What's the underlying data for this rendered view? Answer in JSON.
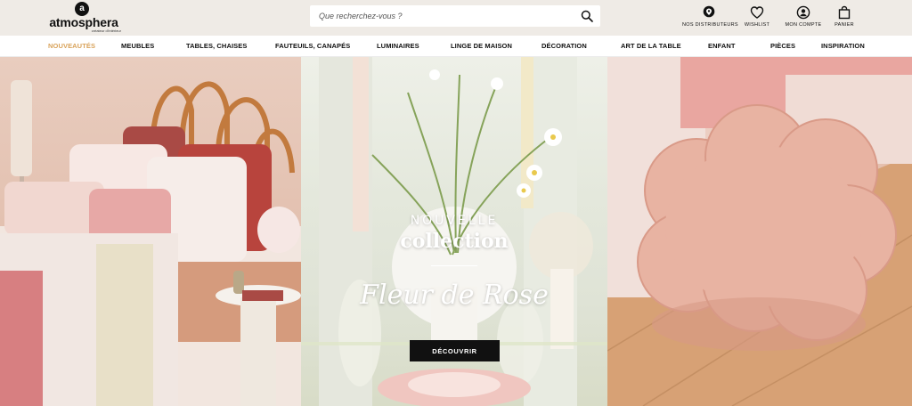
{
  "header": {
    "logo": {
      "mark": "a",
      "word": "atmosphera",
      "tagline": "créateur d'intérieur"
    },
    "search": {
      "placeholder": "Que recherchez-vous ?"
    },
    "utilities": [
      {
        "label": "NOS DISTRIBUTEURS",
        "icon": "location-pin-icon"
      },
      {
        "label": "WISHLIST",
        "icon": "heart-icon"
      },
      {
        "label": "MON COMPTE",
        "icon": "user-icon"
      },
      {
        "label": "PANIER",
        "icon": "bag-icon"
      }
    ]
  },
  "nav": {
    "active_color": "#d9a35b",
    "items": [
      {
        "label": "NOUVEAUTÉS",
        "active": true
      },
      {
        "label": "MEUBLES"
      },
      {
        "label": "TABLES, CHAISES"
      },
      {
        "label": "FAUTEUILS, CANAPÉS"
      },
      {
        "label": "LUMINAIRES"
      },
      {
        "label": "LINGE DE MAISON"
      },
      {
        "label": "DÉCORATION"
      },
      {
        "label": "ART DE LA TABLE"
      },
      {
        "label": "ENFANT"
      },
      {
        "label": "PIÈCES"
      },
      {
        "label": "INSPIRATION"
      }
    ]
  },
  "hero": {
    "eyebrow": "NOUVELLE",
    "title": "collection",
    "subtitle": "Fleur de Rose",
    "cta": "DÉCOUVRIR"
  }
}
